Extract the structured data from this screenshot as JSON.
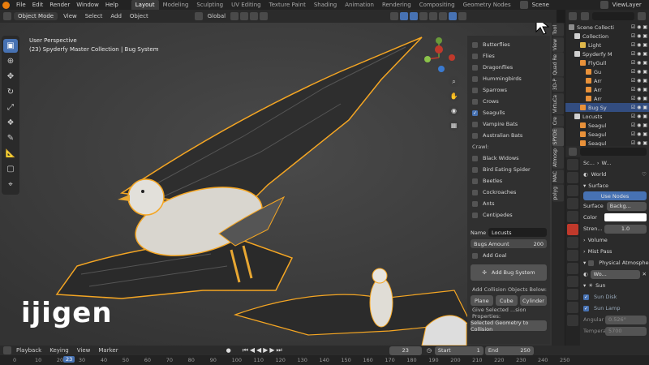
{
  "menu": {
    "items": [
      "File",
      "Edit",
      "Render",
      "Window",
      "Help"
    ]
  },
  "workspaces": {
    "active": "Layout",
    "tabs": [
      "Layout",
      "Modeling",
      "Sculpting",
      "UV Editing",
      "Texture Paint",
      "Shading",
      "Animation",
      "Rendering",
      "Compositing",
      "Geometry Nodes"
    ]
  },
  "scene": {
    "name": "Scene"
  },
  "viewlayer": {
    "name": "ViewLayer"
  },
  "viewport_header": {
    "mode": "Object Mode",
    "menus": [
      "View",
      "Select",
      "Add",
      "Object"
    ],
    "orientation": "Global"
  },
  "viewport": {
    "perspective": "User Perspective",
    "context": "(23) Spyderfy Master Collection | Bug System",
    "watermark": "ijigen"
  },
  "bug_panel": {
    "fly_items": [
      {
        "label": "Butterflies",
        "checked": false
      },
      {
        "label": "Flies",
        "checked": false
      },
      {
        "label": "Dragonflies",
        "checked": false
      },
      {
        "label": "Hummingbirds",
        "checked": false
      },
      {
        "label": "Sparrows",
        "checked": false
      },
      {
        "label": "Crows",
        "checked": false
      },
      {
        "label": "Seagulls",
        "checked": true
      },
      {
        "label": "Vampire Bats",
        "checked": false
      },
      {
        "label": "Australian Bats",
        "checked": false
      }
    ],
    "crawl_label": "Crawl:",
    "crawl_items": [
      {
        "label": "Black Widows",
        "checked": false
      },
      {
        "label": "Bird Eating Spider",
        "checked": false
      },
      {
        "label": "Beetles",
        "checked": false
      },
      {
        "label": "Cockroaches",
        "checked": false
      },
      {
        "label": "Ants",
        "checked": false
      },
      {
        "label": "Centipedes",
        "checked": false
      }
    ],
    "name_label": "Name",
    "name_value": "Locusts",
    "bugs_amount_label": "Bugs Amount",
    "bugs_amount_value": "200",
    "add_goal_label": "Add Goal",
    "add_bug_system_label": "Add Bug System",
    "collision_label": "Add Collision Objects Below:",
    "collision_buttons": [
      "Plane",
      "Cube",
      "Cylinder"
    ],
    "give_selected_label": "Give Selected ...sion Properties:",
    "selected_to_collision_label": "Selected Geometry to Collision"
  },
  "side_tabs": [
    "Tool",
    "View",
    "Quad Re",
    "3D-P",
    "VirtuCa",
    "Cre",
    "SPYDE",
    "Atmosp",
    "MAC",
    "polyg"
  ],
  "outliner": {
    "rows": [
      {
        "label": "Scene Collecti",
        "indent": 0,
        "selected": false,
        "color": "#8c8c8c"
      },
      {
        "label": "Collection",
        "indent": 1,
        "selected": false,
        "color": "#d0d0d0"
      },
      {
        "label": "Light",
        "indent": 2,
        "selected": false,
        "color": "#e0b84a"
      },
      {
        "label": "Spyderfy M",
        "indent": 1,
        "selected": false,
        "color": "#d0d0d0"
      },
      {
        "label": "FlyGull",
        "indent": 2,
        "selected": false,
        "color": "#e8913a"
      },
      {
        "label": "Gu",
        "indent": 3,
        "selected": false,
        "color": "#e8913a"
      },
      {
        "label": "Arr",
        "indent": 3,
        "selected": false,
        "color": "#e8913a"
      },
      {
        "label": "Arr",
        "indent": 3,
        "selected": false,
        "color": "#e8913a"
      },
      {
        "label": "Arr",
        "indent": 3,
        "selected": false,
        "color": "#e8913a"
      },
      {
        "label": "Bug Sy",
        "indent": 2,
        "selected": true,
        "color": "#e8913a"
      },
      {
        "label": "Locusts",
        "indent": 1,
        "selected": false,
        "color": "#d0d0d0"
      },
      {
        "label": "Seagul",
        "indent": 2,
        "selected": false,
        "color": "#e8913a"
      },
      {
        "label": "Seagul",
        "indent": 2,
        "selected": false,
        "color": "#e8913a"
      },
      {
        "label": "Seagul",
        "indent": 2,
        "selected": false,
        "color": "#e8913a"
      }
    ]
  },
  "properties": {
    "breadcrumb_scene": "Sc...",
    "breadcrumb_world": "W...",
    "world_name": "World",
    "surface_label": "Surface",
    "use_nodes_label": "Use Nodes",
    "surface_field_label": "Surface",
    "surface_field_value": "Backg...",
    "color_label": "Color",
    "strength_label": "Stren...",
    "strength_value": "1.0",
    "volume_label": "Volume",
    "mist_pass_label": "Mist Pass",
    "physical_atmosphere_label": "Physical Atmospher",
    "world_short": "Wo...",
    "sun_label": "Sun",
    "sun_disk_label": "Sun Disk",
    "sun_lamp_label": "Sun Lamp",
    "angle_label": "Angular",
    "angle_value": "0.526°",
    "temperature_label": "Tempera",
    "temperature_value": "5700"
  },
  "timeline": {
    "menus": [
      "Playback",
      "Keying",
      "View",
      "Marker"
    ],
    "current_frame": "23",
    "start_label": "Start",
    "start_value": "1",
    "end_label": "End",
    "end_value": "250",
    "ruler_ticks": [
      "0",
      "10",
      "20",
      "30",
      "40",
      "50",
      "60",
      "70",
      "80",
      "90",
      "100",
      "110",
      "120",
      "130",
      "140",
      "150",
      "160",
      "170",
      "180",
      "190",
      "200",
      "210",
      "220",
      "230",
      "240",
      "250"
    ]
  },
  "colors": {
    "accent": "#4772b3",
    "selection_outline": "#f5a623",
    "blender_orange": "#e87d0d"
  }
}
